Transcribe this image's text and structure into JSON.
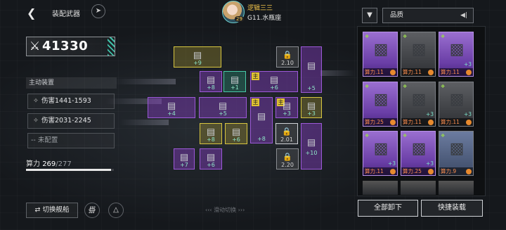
{
  "header": {
    "back_icon": "arrow-left-icon",
    "title": "装配武器",
    "rocket_icon": "rocket-icon"
  },
  "player": {
    "name": "逻辑三三",
    "level": "29",
    "ship": "G11.水瓶座"
  },
  "power": {
    "value": "41330"
  },
  "active": {
    "heading": "主动装置",
    "slots": [
      {
        "icon": "claw-icon",
        "label": "伤害1441-1593"
      },
      {
        "icon": "claw-icon",
        "label": "伤害2031-2245"
      },
      {
        "icon": "dash-icon",
        "label": "-- 未配置"
      }
    ]
  },
  "calc": {
    "label": "算力",
    "used": "269",
    "total": "/277",
    "fraction": 0.971
  },
  "grid": {
    "lock_levels": [
      "2.10",
      "2.01",
      "2.20"
    ],
    "zhu": "主",
    "bonuses": [
      "+9",
      "+8",
      "+1",
      "+6",
      "+5",
      "+4",
      "+5",
      "+3",
      "+3",
      "+6",
      "+8",
      "+8",
      "+6",
      "+10",
      "+7",
      "+6"
    ]
  },
  "bottom": {
    "switch_ship": "切换舰船",
    "swipe_hint": "滑动切换"
  },
  "right": {
    "sort_label": "品质",
    "cards": [
      {
        "stat": "算力.11",
        "plus": ""
      },
      {
        "stat": "算力.11",
        "plus": ""
      },
      {
        "stat": "算力.11",
        "plus": "+3"
      },
      {
        "stat": "算力.25",
        "plus": ""
      },
      {
        "stat": "算力.11",
        "plus": "+3"
      },
      {
        "stat": "算力.11",
        "plus": "+3"
      },
      {
        "stat": "算力.11",
        "plus": "+3"
      },
      {
        "stat": "算力.25",
        "plus": "+3"
      },
      {
        "stat": "算力.9",
        "plus": ""
      }
    ],
    "unload_all": "全部卸下",
    "quick_equip": "快捷装载"
  },
  "colors": {
    "accent": "#3fc0a8",
    "purple": "#9c59d8",
    "yellow": "#d8c640",
    "orange": "#ff8f4f"
  }
}
